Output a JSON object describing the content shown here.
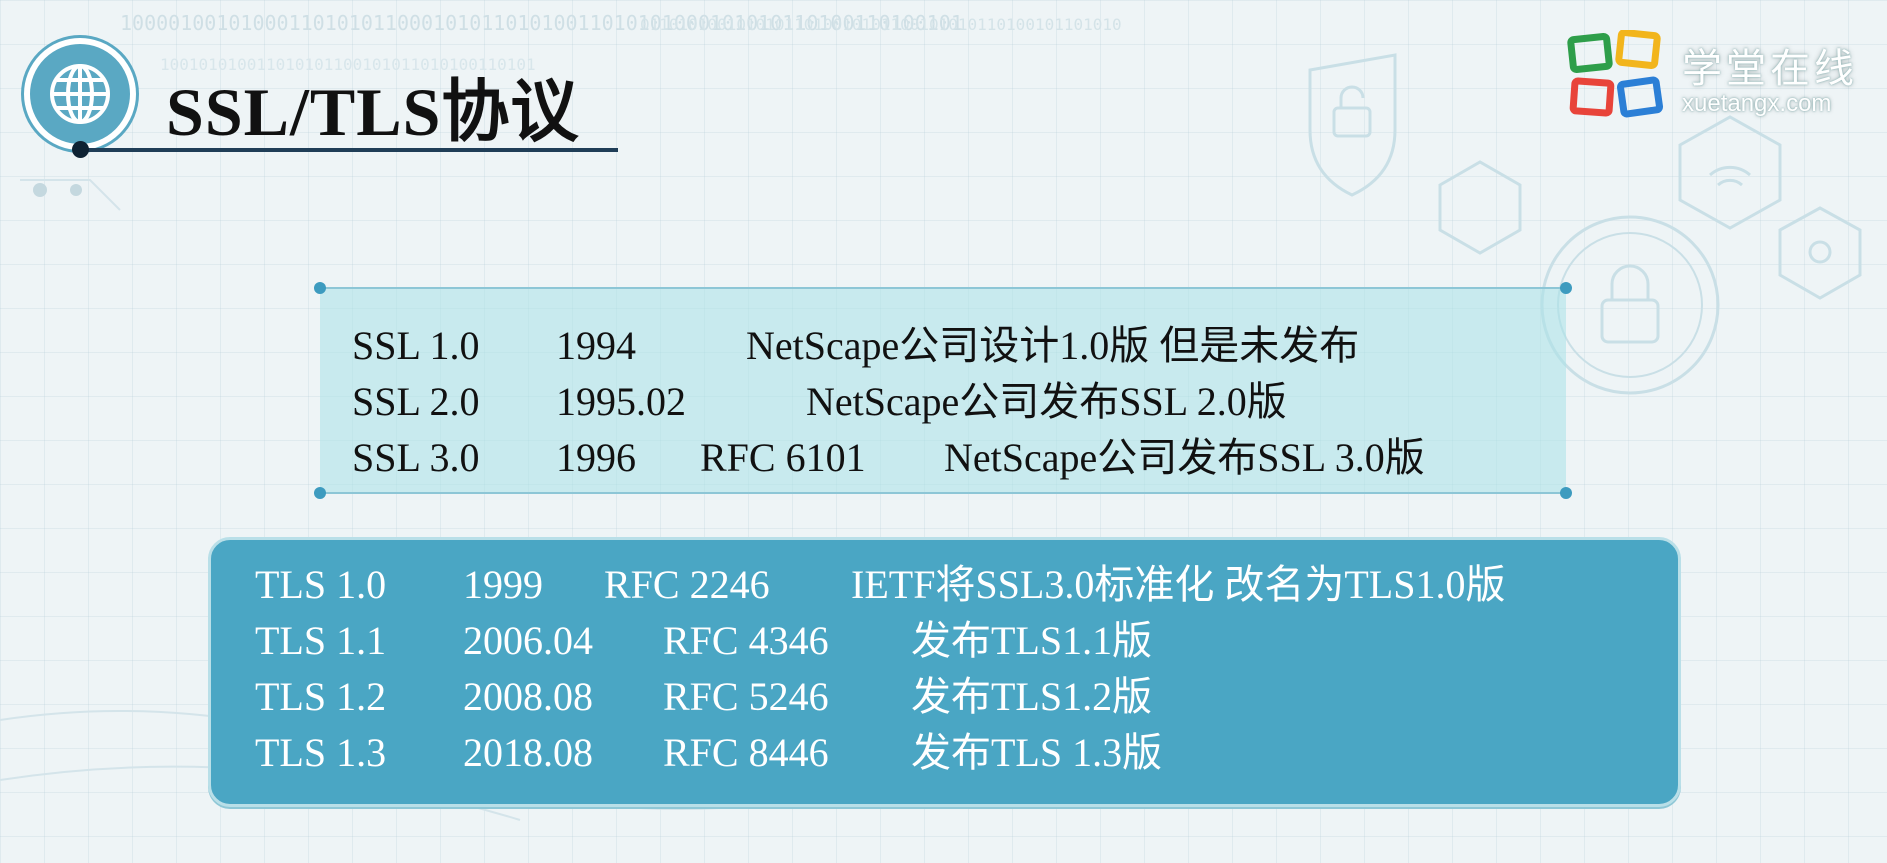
{
  "slide": {
    "title": "SSL/TLS协议",
    "logo_cn": "学堂在线",
    "logo_en": "xuetangx.com",
    "colors": {
      "tls_panel": "#4aa6c4",
      "ssl_panel": "#aae1e8",
      "accent": "#5aa8c3"
    }
  },
  "ssl": [
    {
      "version": "SSL 1.0",
      "date": "1994",
      "rfc": "",
      "desc": "NetScape公司设计1.0版 但是未发布"
    },
    {
      "version": "SSL 2.0",
      "date": "1995.02",
      "rfc": "",
      "desc": "NetScape公司发布SSL 2.0版"
    },
    {
      "version": "SSL 3.0",
      "date": "1996",
      "rfc": "RFC 6101",
      "desc": "NetScape公司发布SSL 3.0版"
    }
  ],
  "tls": [
    {
      "version": "TLS 1.0",
      "date": "1999",
      "rfc": "RFC 2246",
      "desc": "IETF将SSL3.0标准化 改名为TLS1.0版"
    },
    {
      "version": "TLS 1.1",
      "date": "2006.04",
      "rfc": "RFC 4346",
      "desc": "发布TLS1.1版"
    },
    {
      "version": "TLS 1.2",
      "date": "2008.08",
      "rfc": "RFC 5246",
      "desc": "发布TLS1.2版"
    },
    {
      "version": "TLS 1.3",
      "date": "2018.08",
      "rfc": "RFC 8446",
      "desc": "发布TLS 1.3版"
    }
  ]
}
